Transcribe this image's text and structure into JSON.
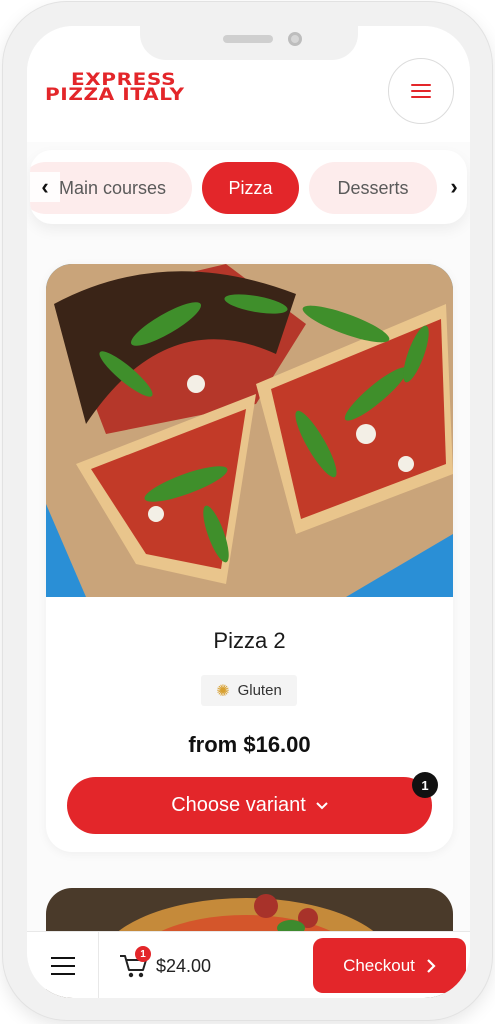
{
  "brand": {
    "logo_line1": "EXPRESS",
    "logo_line2": "PIZZA ITALY",
    "accent": "#e3262a"
  },
  "header": {
    "menu_icon": "hamburger-icon"
  },
  "categories": {
    "items": [
      {
        "label": "Main courses",
        "visible_text": "Main courses"
      },
      {
        "label": "Pizza",
        "active": true
      },
      {
        "label": "Desserts"
      }
    ],
    "prev_icon": "chevron-left-icon",
    "next_icon": "chevron-right-icon"
  },
  "product": {
    "name": "Pizza 2",
    "allergen": "Gluten",
    "allergen_icon": "wheat-icon",
    "price": "from $16.00",
    "button_label": "Choose variant",
    "cart_count": "1"
  },
  "bottom_bar": {
    "menu_icon": "hamburger-icon",
    "cart_icon": "cart-icon",
    "cart_count": "1",
    "total": "$24.00",
    "checkout_label": "Checkout"
  }
}
